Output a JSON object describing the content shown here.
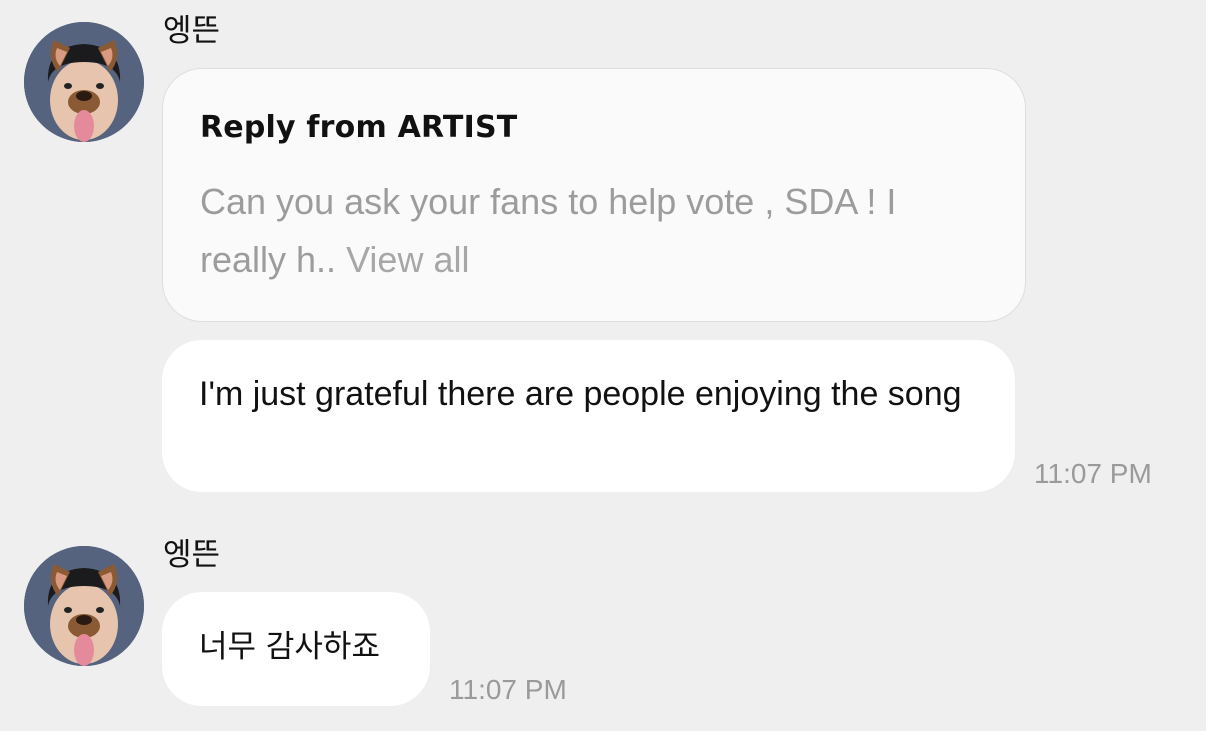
{
  "messages": [
    {
      "sender": "엥뜬",
      "reply": {
        "title": "Reply from ARTIST",
        "preview": "Can you ask your fans to help vote , SDA ! I really h.. ",
        "view_all": "View all"
      },
      "text": "I'm just grateful there are people enjoying the song",
      "time": "11:07 PM"
    },
    {
      "sender": "엥뜬",
      "text": "너무 감사하죠",
      "time": "11:07 PM"
    }
  ],
  "icons": {
    "avatar": "profile-photo-dog-filter"
  }
}
